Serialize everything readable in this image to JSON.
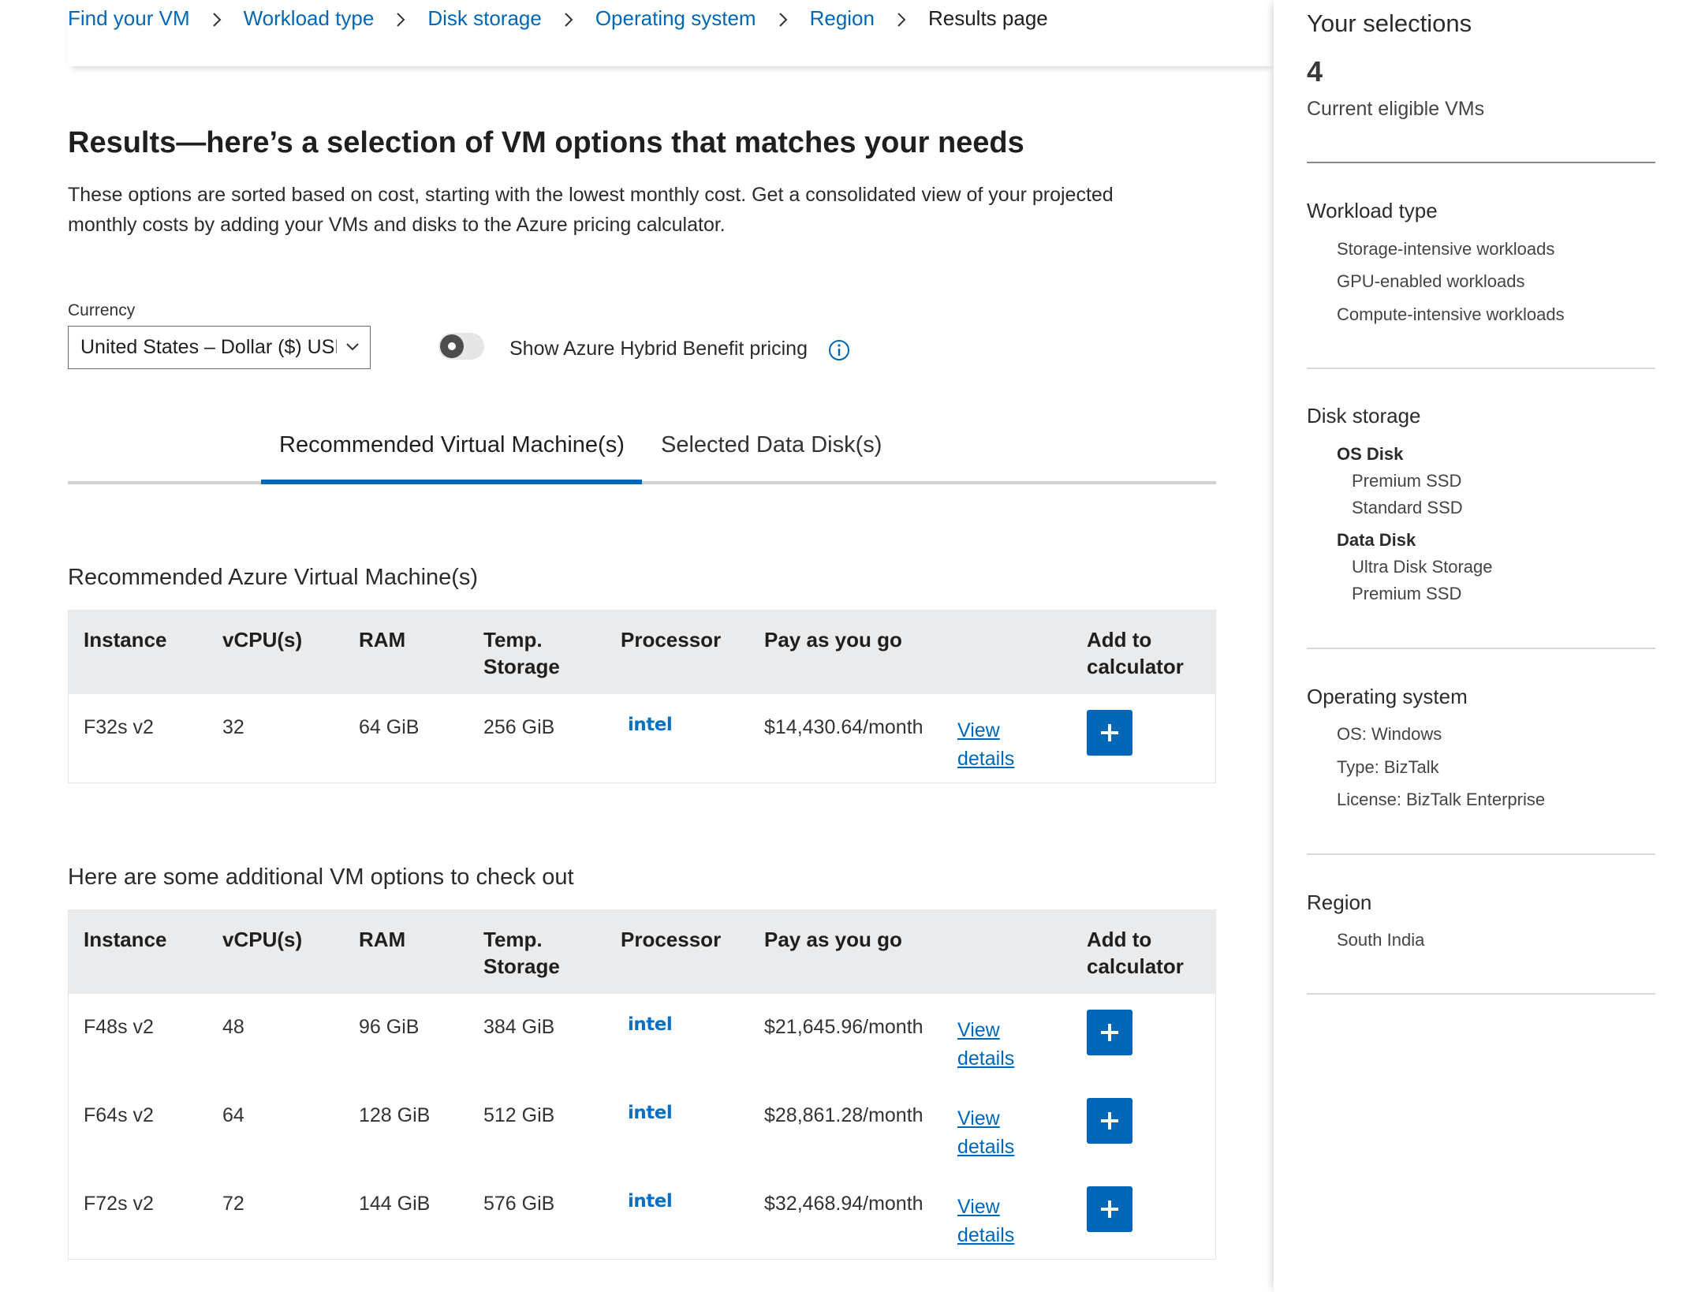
{
  "breadcrumb": {
    "items": [
      "Find your VM",
      "Workload type",
      "Disk storage",
      "Operating system",
      "Region"
    ],
    "current": "Results page"
  },
  "results": {
    "title": "Results—here’s a selection of VM options that matches your needs",
    "description": "These options are sorted based on cost, starting with the lowest monthly cost. Get a consolidated view of your projected monthly costs by adding your VMs and disks to the Azure pricing calculator."
  },
  "currency": {
    "label": "Currency",
    "value": "United States – Dollar ($) USD"
  },
  "hybrid_benefit": {
    "label": "Show Azure Hybrid Benefit pricing",
    "enabled": false
  },
  "tabs": [
    {
      "label": "Recommended Virtual Machine(s)",
      "active": true
    },
    {
      "label": "Selected Data Disk(s)",
      "active": false
    }
  ],
  "columns": [
    "Instance",
    "vCPU(s)",
    "RAM",
    "Temp.\nStorage",
    "Processor",
    "Pay as you go",
    "Add to\ncalculator"
  ],
  "recommended": {
    "title": "Recommended Azure Virtual Machine(s)",
    "rows": [
      {
        "instance": "F32s v2",
        "vcpu": "32",
        "ram": "64 GiB",
        "temp": "256 GiB",
        "processor": "intel",
        "price": "$14,430.64/month",
        "view": "View\ndetails"
      }
    ]
  },
  "additional": {
    "title": "Here are some additional VM options to check out",
    "rows": [
      {
        "instance": "F48s v2",
        "vcpu": "48",
        "ram": "96 GiB",
        "temp": "384 GiB",
        "processor": "intel",
        "price": "$21,645.96/month",
        "view": "View\ndetails"
      },
      {
        "instance": "F64s v2",
        "vcpu": "64",
        "ram": "128 GiB",
        "temp": "512 GiB",
        "processor": "intel",
        "price": "$28,861.28/month",
        "view": "View\ndetails"
      },
      {
        "instance": "F72s v2",
        "vcpu": "72",
        "ram": "144 GiB",
        "temp": "576 GiB",
        "processor": "intel",
        "price": "$32,468.94/month",
        "view": "View\ndetails"
      }
    ]
  },
  "sidebar": {
    "title": "Your selections",
    "count": "4",
    "count_label": "Current eligible VMs",
    "workload": {
      "heading": "Workload type",
      "items": [
        "Storage-intensive workloads",
        "GPU-enabled workloads",
        "Compute-intensive workloads"
      ]
    },
    "disk": {
      "heading": "Disk storage",
      "os_label": "OS Disk",
      "os_items": [
        "Premium SSD",
        "Standard SSD"
      ],
      "data_label": "Data Disk",
      "data_items": [
        "Ultra Disk Storage",
        "Premium SSD"
      ]
    },
    "os": {
      "heading": "Operating system",
      "items": [
        "OS: Windows",
        "Type: BizTalk",
        "License: BizTalk Enterprise"
      ]
    },
    "region": {
      "heading": "Region",
      "items": [
        "South India"
      ]
    }
  },
  "colors": {
    "accent": "#0067b8",
    "intel": "#0071c5",
    "table_header": "#eaebec"
  }
}
